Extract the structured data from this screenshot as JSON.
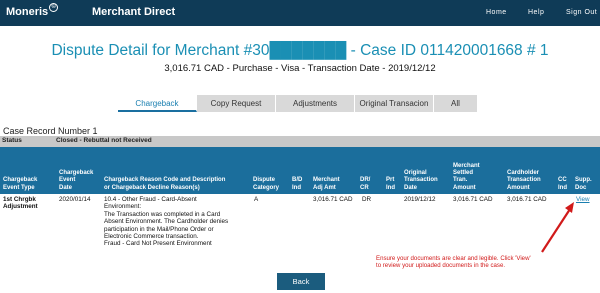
{
  "header": {
    "brand": "Moneris",
    "brand_mark": "©",
    "product": "Merchant Direct",
    "nav": [
      "Home",
      "Help",
      "Sign Out"
    ]
  },
  "page": {
    "title": "Dispute Detail for Merchant #30███████ - Case ID 011420001668 # 1",
    "subtitle": "3,016.71 CAD - Purchase - Visa - Transaction Date - 2019/12/12"
  },
  "tabs": [
    "Chargeback",
    "Copy Request",
    "Adjustments",
    "Original Transacion",
    "All"
  ],
  "case": {
    "record_label": "Case Record Number 1",
    "status_label": "Status",
    "status_value": "Closed - Rebuttal not Received"
  },
  "table": {
    "headers": {
      "event_type": [
        "Chargeback",
        "Event Type"
      ],
      "event_date": [
        "Chargeback",
        "Event",
        "Date"
      ],
      "reason": [
        "Chargeback Reason Code and Description",
        "or Chargeback Decline Reason(s)"
      ],
      "category": [
        "Dispute",
        "Category"
      ],
      "bd": [
        "B/D",
        "Ind"
      ],
      "merchant_adj": [
        "Merchant",
        "Adj Amt"
      ],
      "drcr": [
        "DR/",
        "CR"
      ],
      "prt": [
        "Prt",
        "Ind"
      ],
      "orig_date": [
        "Original",
        "Transaction",
        "Date"
      ],
      "settled": [
        "Merchant",
        "Settled",
        "Tran.",
        "Amount"
      ],
      "cardholder": [
        "Cardholder",
        "Transaction",
        "Amount"
      ],
      "cc": [
        "CC",
        "Ind"
      ],
      "supp": [
        "Supp.",
        "Doc"
      ]
    },
    "row": {
      "event_type": [
        "1st Chrgbk",
        "Adjustment"
      ],
      "event_date": "2020/01/14",
      "reason": [
        "10.4 - Other Fraud - Card-Absent",
        "Environment:",
        "The Transaction was completed in a Card",
        "Absent Environment. The Cardholder denies",
        "participation in the Mail/Phone Order or",
        "Electronic Commerce transaction.",
        "Fraud - Card Not Present Environment"
      ],
      "category": "A",
      "merchant_adj": "3,016.71 CAD",
      "drcr": "DR",
      "orig_date": "2019/12/12",
      "settled": "3,016.71 CAD",
      "cardholder": "3,016.71 CAD",
      "supp": "View"
    }
  },
  "note": [
    "Ensure your documents are clear and legible. Click 'View'",
    "to review your uploaded documents in the case."
  ],
  "back_label": "Back",
  "colors": {
    "topbar": "#0f3b57",
    "accent": "#1a8fb4",
    "table_header": "#1b6e9c",
    "note": "#d11a1a"
  }
}
